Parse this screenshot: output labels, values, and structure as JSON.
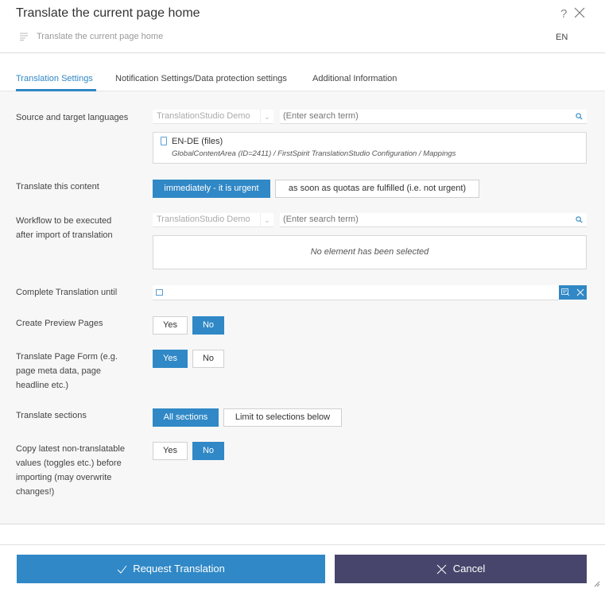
{
  "header": {
    "title": "Translate the current page home",
    "help_label": "?",
    "subtitle": "Translate the current page home",
    "language": "EN"
  },
  "tabs": [
    {
      "label": "Translation Settings",
      "active": true
    },
    {
      "label": "Notification Settings/Data protection settings",
      "active": false
    },
    {
      "label": "Additional Information",
      "active": false
    }
  ],
  "form": {
    "source_target": {
      "label": "Source and target languages",
      "project_select": "TranslationStudio Demo",
      "search_placeholder": "(Enter search term)",
      "selected_item": {
        "title": "EN-DE (files)",
        "path": "GlobalContentArea (ID=2411) / FirstSpirit TranslationStudio Configuration / Mappings"
      }
    },
    "translate_content": {
      "label": "Translate this content",
      "options": [
        "immediately - it is urgent",
        "as soon as quotas are fulfilled (i.e. not urgent)"
      ],
      "selected": 0
    },
    "workflow": {
      "label": "Workflow to be executed after import of translation",
      "project_select": "TranslationStudio Demo",
      "search_placeholder": "(Enter search term)",
      "empty_text": "No element has been selected"
    },
    "complete_until": {
      "label": "Complete Translation until",
      "value": ""
    },
    "preview_pages": {
      "label": "Create Preview Pages",
      "options": [
        "Yes",
        "No"
      ],
      "selected": 1
    },
    "page_form": {
      "label": "Translate Page Form (e.g. page meta data, page headline etc.)",
      "options": [
        "Yes",
        "No"
      ],
      "selected": 0
    },
    "sections": {
      "label": "Translate sections",
      "options": [
        "All sections",
        "Limit to selections below"
      ],
      "selected": 0
    },
    "copy_values": {
      "label": "Copy latest non-translatable values (toggles etc.) before importing (may overwrite changes!)",
      "options": [
        "Yes",
        "No"
      ],
      "selected": 1
    }
  },
  "footer": {
    "request_label": "Request Translation",
    "cancel_label": "Cancel"
  },
  "colors": {
    "accent": "#3088c6",
    "cancel": "#47456b",
    "background": "#f7f7f7"
  }
}
